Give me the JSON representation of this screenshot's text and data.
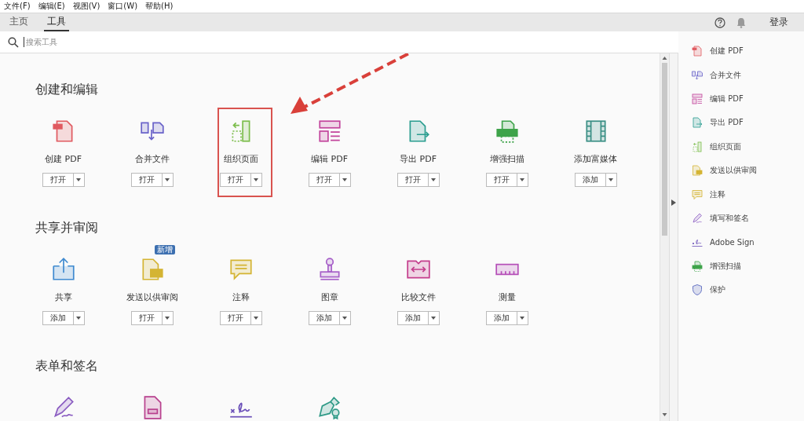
{
  "menu": [
    "文件(F)",
    "编辑(E)",
    "视图(V)",
    "窗口(W)",
    "帮助(H)"
  ],
  "tabs": [
    {
      "label": "主页",
      "selected": false
    },
    {
      "label": "工具",
      "selected": true
    }
  ],
  "header_right": {
    "login": "登录"
  },
  "search": {
    "placeholder": "搜索工具"
  },
  "sections": [
    {
      "title": "创建和编辑",
      "tools": [
        {
          "kind": "create",
          "label": "创建 PDF",
          "button": "打开",
          "highlighted": false
        },
        {
          "kind": "combine",
          "label": "合并文件",
          "button": "打开",
          "highlighted": false
        },
        {
          "kind": "organize",
          "label": "组织页面",
          "button": "打开",
          "highlighted": true
        },
        {
          "kind": "edit",
          "label": "编辑 PDF",
          "button": "打开",
          "highlighted": false
        },
        {
          "kind": "export",
          "label": "导出 PDF",
          "button": "打开",
          "highlighted": false
        },
        {
          "kind": "scan",
          "label": "增强扫描",
          "button": "打开",
          "highlighted": false
        },
        {
          "kind": "media",
          "label": "添加富媒体",
          "button": "添加",
          "highlighted": false
        }
      ]
    },
    {
      "title": "共享并审阅",
      "tools": [
        {
          "kind": "share",
          "label": "共享",
          "button": "添加",
          "highlighted": false
        },
        {
          "kind": "send",
          "label": "发送以供审阅",
          "button": "打开",
          "badge": "新增",
          "highlighted": false
        },
        {
          "kind": "comment",
          "label": "注释",
          "button": "打开",
          "highlighted": false
        },
        {
          "kind": "stamp",
          "label": "图章",
          "button": "添加",
          "highlighted": false
        },
        {
          "kind": "compare",
          "label": "比较文件",
          "button": "添加",
          "highlighted": false
        },
        {
          "kind": "measure",
          "label": "测量",
          "button": "添加",
          "highlighted": false
        }
      ]
    },
    {
      "title": "表单和签名",
      "tools": [
        {
          "kind": "fillsign",
          "highlighted": false
        },
        {
          "kind": "form",
          "highlighted": false
        },
        {
          "kind": "sign",
          "highlighted": false
        },
        {
          "kind": "certificate",
          "highlighted": false
        }
      ]
    }
  ],
  "sidebar": {
    "items": [
      {
        "kind": "create",
        "label": "创建 PDF"
      },
      {
        "kind": "combine",
        "label": "合并文件"
      },
      {
        "kind": "edit",
        "label": "编辑 PDF"
      },
      {
        "kind": "export",
        "label": "导出 PDF"
      },
      {
        "kind": "organize",
        "label": "组织页面"
      },
      {
        "kind": "send",
        "label": "发送以供审阅"
      },
      {
        "kind": "comment",
        "label": "注释"
      },
      {
        "kind": "fillsign",
        "label": "填写和签名"
      },
      {
        "kind": "sign",
        "label": "Adobe Sign"
      },
      {
        "kind": "scan",
        "label": "增强扫描"
      },
      {
        "kind": "protect",
        "label": "保护"
      }
    ]
  }
}
